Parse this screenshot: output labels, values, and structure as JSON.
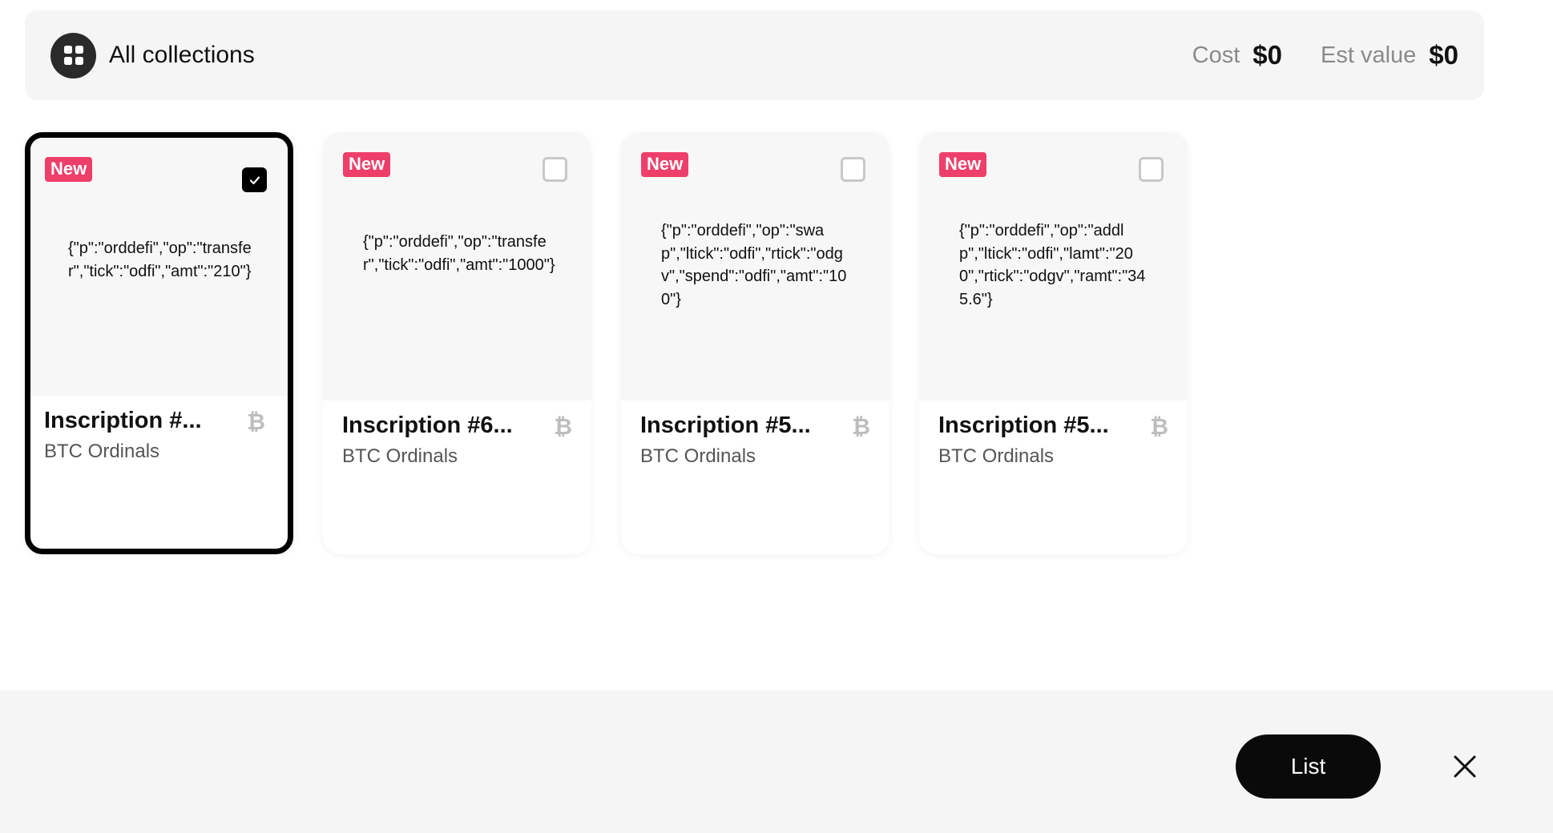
{
  "header": {
    "title": "All collections",
    "cost_label": "Cost",
    "cost_value": "$0",
    "est_label": "Est value",
    "est_value": "$0"
  },
  "cards": [
    {
      "badge": "New",
      "selected": true,
      "content": "{\"p\":\"orddefi\",\"op\":\"transfer\",\"tick\":\"odfi\",\"amt\":\"210\"}",
      "title": "Inscription #...",
      "subtitle": "BTC Ordinals",
      "chain_icon": "bitcoin-icon"
    },
    {
      "badge": "New",
      "selected": false,
      "content": "{\"p\":\"orddefi\",\"op\":\"transfer\",\"tick\":\"odfi\",\"amt\":\"1000\"}",
      "title": "Inscription #6...",
      "subtitle": "BTC Ordinals",
      "chain_icon": "bitcoin-icon"
    },
    {
      "badge": "New",
      "selected": false,
      "content": "{\"p\":\"orddefi\",\"op\":\"swap\",\"ltick\":\"odfi\",\"rtick\":\"odgv\",\"spend\":\"odfi\",\"amt\":\"100\"}",
      "title": "Inscription #5...",
      "subtitle": "BTC Ordinals",
      "chain_icon": "bitcoin-icon"
    },
    {
      "badge": "New",
      "selected": false,
      "content": "{\"p\":\"orddefi\",\"op\":\"addlp\",\"ltick\":\"odfi\",\"lamt\":\"200\",\"rtick\":\"odgv\",\"ramt\":\"345.6\"}",
      "title": "Inscription #5...",
      "subtitle": "BTC Ordinals",
      "chain_icon": "bitcoin-icon"
    }
  ],
  "footer": {
    "list_label": "List",
    "close_icon": "close-icon"
  },
  "colors": {
    "badge": "#ee3f6a",
    "primary_button": "#0a0a0a",
    "panel_bg": "#f5f5f5"
  }
}
